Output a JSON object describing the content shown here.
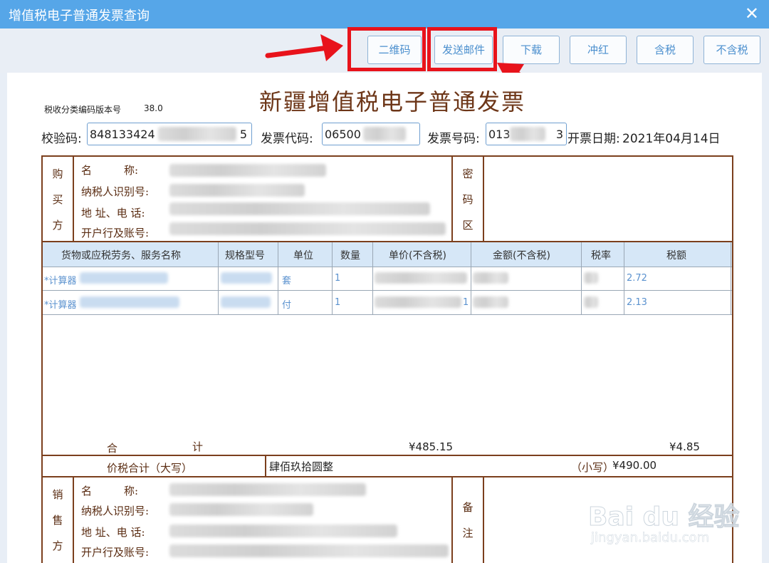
{
  "window": {
    "title": "增值税电子普通发票查询",
    "close_glyph": "✕"
  },
  "toolbar": {
    "buttons": [
      {
        "id": "qrcode",
        "label": "二维码"
      },
      {
        "id": "send_mail",
        "label": "发送邮件"
      },
      {
        "id": "download",
        "label": "下载"
      },
      {
        "id": "red_reverse",
        "label": "冲红"
      },
      {
        "id": "with_tax",
        "label": "含税"
      },
      {
        "id": "without_tax",
        "label": "不含税"
      }
    ]
  },
  "invoice": {
    "title": "新疆增值税电子普通发票",
    "version_label": "税收分类编码版本号",
    "version_value": "38.0",
    "check_code_label": "校验码:",
    "check_code_value": "848133424",
    "check_code_tail": "5",
    "invoice_code_label": "发票代码:",
    "invoice_code_value": "06500",
    "invoice_number_label": "发票号码:",
    "invoice_number_value": "013",
    "invoice_number_tail": "3",
    "date_label": "开票日期:",
    "date_value": "2021年04月14日"
  },
  "buyer": {
    "side_label": [
      "购",
      "买",
      "方"
    ],
    "name_label": "名　　　称:",
    "tax_id_label": "纳税人识别号:",
    "address_label": "地 址、电 话:",
    "bank_label": "开户行及账号:",
    "cipher_label": [
      "密",
      "码",
      "区"
    ]
  },
  "table": {
    "headers": [
      "货物或应税劳务、服务名称",
      "规格型号",
      "单位",
      "数量",
      "单价(不含税)",
      "金额(不含税)",
      "税率",
      "税额"
    ],
    "rows": [
      {
        "name": "*计算器",
        "unit": "套",
        "qty": "1",
        "tax": "2.72"
      },
      {
        "name": "*计算器",
        "unit": "付",
        "qty": "1",
        "price_tail": "1",
        "tax": "2.13"
      }
    ]
  },
  "totals": {
    "label_he": "合",
    "label_ji": "计",
    "amount": "¥485.15",
    "tax": "¥4.85",
    "capital_label": "价税合计（大写）",
    "capital_value": "肆佰玖拾圆整",
    "small_label": "（小写）",
    "small_value": "¥490.00"
  },
  "seller": {
    "side_label": [
      "销",
      "售",
      "方"
    ],
    "name_label": "名　　　称:",
    "tax_id_label": "纳税人识别号:",
    "address_label": "地 址、电 话:",
    "bank_label": "开户行及账号:",
    "remark_label": [
      "备",
      "注"
    ]
  },
  "watermark": {
    "brand": "Bai du 经验",
    "url": "jingyan.baidu.com"
  },
  "colors": {
    "titlebar": "#56a6e8",
    "highlight": "#e8131b",
    "invoice_brown": "#7b3f1d",
    "link_blue": "#5b92cf"
  }
}
